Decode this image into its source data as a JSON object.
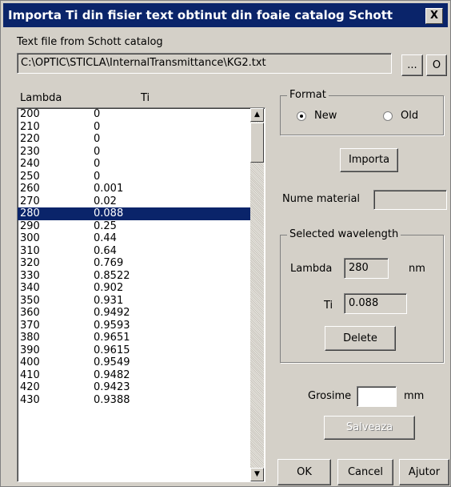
{
  "window": {
    "title": "Importa Ti din fisier text obtinut din foaie catalog Schott",
    "close_glyph": "X"
  },
  "file": {
    "label": "Text file from Schott catalog",
    "path": "C:\\OPTIC\\STICLA\\InternalTransmittance\\KG2.txt",
    "browse_label": "...",
    "open_label": "O"
  },
  "list": {
    "headers": {
      "lambda": "Lambda",
      "ti": "Ti"
    },
    "rows": [
      {
        "lambda": "200",
        "ti": "0"
      },
      {
        "lambda": "210",
        "ti": "0"
      },
      {
        "lambda": "220",
        "ti": "0"
      },
      {
        "lambda": "230",
        "ti": "0"
      },
      {
        "lambda": "240",
        "ti": "0"
      },
      {
        "lambda": "250",
        "ti": "0"
      },
      {
        "lambda": "260",
        "ti": "0.001"
      },
      {
        "lambda": "270",
        "ti": "0.02"
      },
      {
        "lambda": "280",
        "ti": "0.088"
      },
      {
        "lambda": "290",
        "ti": "0.25"
      },
      {
        "lambda": "300",
        "ti": "0.44"
      },
      {
        "lambda": "310",
        "ti": "0.64"
      },
      {
        "lambda": "320",
        "ti": "0.769"
      },
      {
        "lambda": "330",
        "ti": "0.8522"
      },
      {
        "lambda": "340",
        "ti": "0.902"
      },
      {
        "lambda": "350",
        "ti": "0.931"
      },
      {
        "lambda": "360",
        "ti": "0.9492"
      },
      {
        "lambda": "370",
        "ti": "0.9593"
      },
      {
        "lambda": "380",
        "ti": "0.9651"
      },
      {
        "lambda": "390",
        "ti": "0.9615"
      },
      {
        "lambda": "400",
        "ti": "0.9549"
      },
      {
        "lambda": "410",
        "ti": "0.9482"
      },
      {
        "lambda": "420",
        "ti": "0.9423"
      },
      {
        "lambda": "430",
        "ti": "0.9388"
      }
    ],
    "selected_index": 8,
    "scroll_up_glyph": "▲",
    "scroll_down_glyph": "▼"
  },
  "format": {
    "title": "Format",
    "options": [
      {
        "label": "New",
        "checked": true
      },
      {
        "label": "Old",
        "checked": false
      }
    ]
  },
  "importa_label": "Importa",
  "material": {
    "label": "Nume material",
    "value": ""
  },
  "selected": {
    "title": "Selected wavelength",
    "lambda_label": "Lambda",
    "lambda_value": "280",
    "lambda_unit": "nm",
    "ti_label": "Ti",
    "ti_value": "0.088",
    "delete_label": "Delete"
  },
  "grosime": {
    "label": "Grosime",
    "value": "",
    "unit": "mm"
  },
  "salveaza_label": "Salveaza",
  "footer": {
    "ok_label": "OK",
    "cancel_label": "Cancel",
    "ajutor_label": "Ajutor"
  },
  "colors": {
    "titlebar": "#0a246a",
    "selection": "#0a246a",
    "face": "#d4d0c8"
  }
}
